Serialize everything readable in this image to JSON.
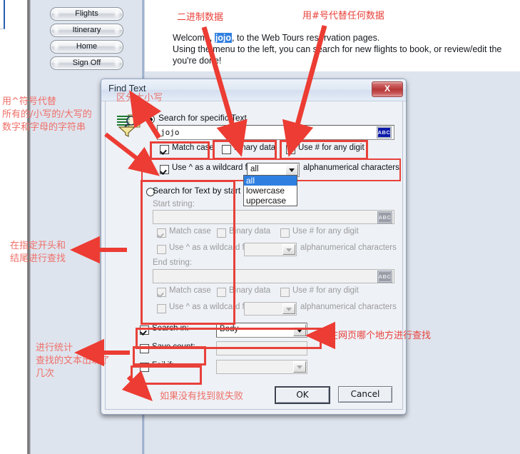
{
  "page": {
    "nav_buttons": [
      {
        "label": "Flights"
      },
      {
        "label": "Itinerary"
      },
      {
        "label": "Home"
      },
      {
        "label": "Sign Off"
      }
    ],
    "welcome": {
      "line1_pre": "Welcome, ",
      "user": "jojo",
      "line1_post": ", to the Web Tours reservation pages.",
      "line2": "Using the menu to the left, you can search for new flights to book, or review/edit the",
      "line3": "you're done!"
    }
  },
  "dialog": {
    "title": "Find Text",
    "close_label": "X",
    "icon": "find-text-icon",
    "radio_specific_text": "Search for specific Text",
    "search_value": "jojo",
    "abc_label": "ABC",
    "match_case": "Match case",
    "binary_data": "Binary data",
    "use_hash": "Use # for any digit",
    "wildcard_label": "Use ^ as a wildcard for",
    "wildcard_value": "all",
    "alphanumeric": "alphanumerical characters",
    "dropdown_options": [
      "all",
      "lowercase",
      "uppercase"
    ],
    "dropdown_selected": "all",
    "radio_start_end": "Search for Text by start and",
    "start_string_label": "Start string:",
    "start_string_value": "",
    "end_string_label": "End string:",
    "end_string_value": "",
    "search_in_label": "Search in:",
    "search_in_value": "Body",
    "save_count_label": "Save count:",
    "save_count_value": "",
    "fail_if_label": "Fail if:",
    "fail_if_value": "",
    "ok_label": "OK",
    "cancel_label": "Cancel"
  },
  "annotations": {
    "binary_data": "二进制数据",
    "hash_any_data": "用#号代替任何数据",
    "case_sensitive": "区分大小写",
    "wildcard": "用^符号代替\n所有的/小写的/大写的\n数字和字母的字符串",
    "start_end": "在指定开头和\n结尾进行查找",
    "count": "进行统计\n查找的文本出现了\n几次",
    "where_in_page": "在网页哪个地方进行查找",
    "fail_if_not_found": "如果没有找到就失败"
  },
  "colors": {
    "annotation_red": "#e8413a",
    "highlight_blue": "#2f7fe0",
    "sidebar": "#dee4ee",
    "dialog_bg": "#eef1f6"
  }
}
